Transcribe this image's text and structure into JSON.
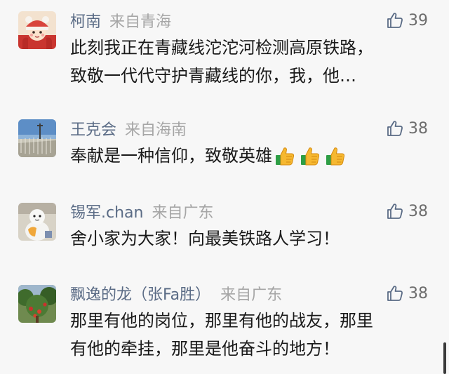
{
  "comments": [
    {
      "username": "柯南",
      "location": "来自青海",
      "likes": "39",
      "lines": [
        "此刻我正在青藏线沱沱河检测高原铁路，",
        "致敬一代代守护青藏线的你，我，他…"
      ],
      "avatar_icon": "cartoon-girl-avatar"
    },
    {
      "username": "王克会",
      "location": "来自海南",
      "likes": "38",
      "lines": [
        "奉献是一种信仰，致敬英雄"
      ],
      "emoji": [
        "thumbs-up-emoji",
        "thumbs-up-emoji",
        "thumbs-up-emoji"
      ],
      "avatar_icon": "landscape-photo-avatar"
    },
    {
      "username": "锡军.chan",
      "location": "来自广东",
      "likes": "38",
      "lines": [
        "舍小家为大家！向最美铁路人学习！"
      ],
      "avatar_icon": "snowman-figure-avatar"
    },
    {
      "username": "飘逸的龙（张Fa胜）",
      "location": "来自广东",
      "likes": "38",
      "lines": [
        "那里有他的岗位，那里有他的战友，那里",
        "有他的牵挂，那里是他奋斗的地方！"
      ],
      "avatar_icon": "fruit-tree-avatar"
    }
  ],
  "colors": {
    "background": "#f7f7f7",
    "username": "#5a6b85",
    "location": "#a6a6a6",
    "like_icon": "#5a6b85",
    "text": "#1a1a1a"
  }
}
